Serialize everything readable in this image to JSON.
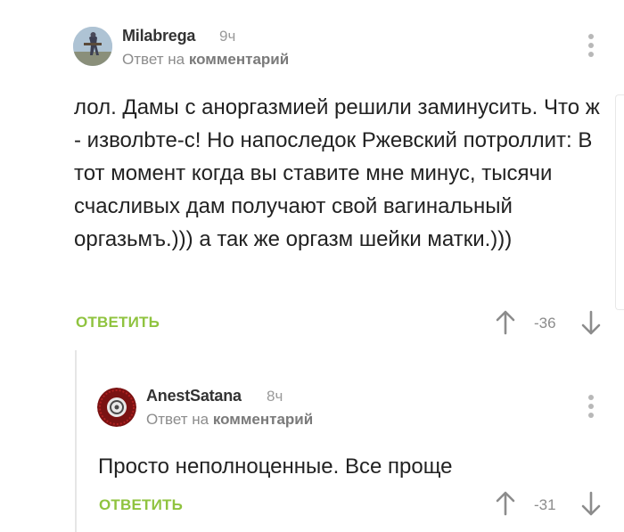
{
  "comments": [
    {
      "author": "Milabrega",
      "time": "9ч",
      "reply_prefix": "Ответ на",
      "reply_target": "комментарий",
      "body": "лол. Дамы с аноргазмией решили заминусить. Что ж - изволbте-с! Но напоследок Ржевский потроллит: В тот момент когда вы ставите мне минус, тысячи счасливых дам получают свой вагинальный оргазьмъ.))) а так же оргазм шейки матки.)))",
      "answer_label": "ОТВЕТИТЬ",
      "score": "-36"
    },
    {
      "author": "AnestSatana",
      "time": "8ч",
      "reply_prefix": "Ответ на",
      "reply_target": "комментарий",
      "body": "Просто неполноценные. Все проще",
      "answer_label": "ОТВЕТИТЬ",
      "score": "-31"
    }
  ],
  "icons": {
    "upvote": "arrow-up-icon",
    "downvote": "arrow-down-icon",
    "menu": "more-vertical-icon"
  },
  "colors": {
    "answer": "#8fc33f",
    "muted": "#8c8c8c",
    "text": "#222222"
  }
}
